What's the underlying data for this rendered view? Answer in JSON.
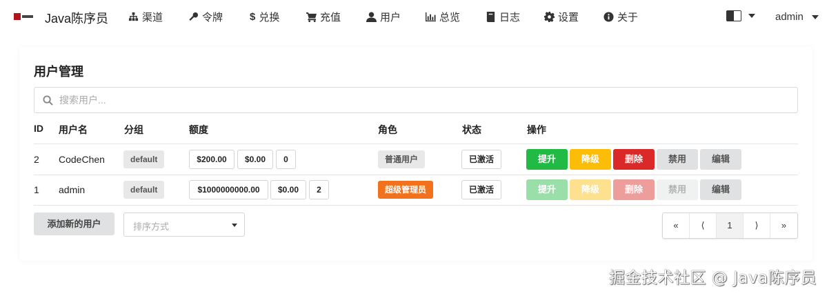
{
  "nav": {
    "brand": "Java陈序员",
    "items": [
      {
        "label": "渠道",
        "icon": "sitemap-icon"
      },
      {
        "label": "令牌",
        "icon": "key-icon"
      },
      {
        "label": "兑换",
        "icon": "dollar-icon"
      },
      {
        "label": "充值",
        "icon": "cart-icon"
      },
      {
        "label": "用户",
        "icon": "user-icon"
      },
      {
        "label": "总览",
        "icon": "bar-chart-icon"
      },
      {
        "label": "日志",
        "icon": "book-icon"
      },
      {
        "label": "设置",
        "icon": "gear-icon"
      },
      {
        "label": "关于",
        "icon": "info-icon"
      }
    ],
    "language_icon": "translate-icon",
    "user": "admin"
  },
  "page": {
    "title": "用户管理",
    "search_placeholder": "搜索用户..."
  },
  "table": {
    "headers": {
      "id": "ID",
      "username": "用户名",
      "group": "分组",
      "quota": "额度",
      "role": "角色",
      "status": "状态",
      "actions": "操作"
    },
    "rows": [
      {
        "id": "2",
        "username": "CodeChen",
        "group": "default",
        "quota": "$200.00",
        "used": "$0.00",
        "requests": "0",
        "role": "普通用户",
        "status": "已激活",
        "actions": {
          "promote": "提升",
          "demote": "降级",
          "delete": "删除",
          "disable": "禁用",
          "edit": "编辑"
        }
      },
      {
        "id": "1",
        "username": "admin",
        "group": "default",
        "quota": "$1000000000.00",
        "used": "$0.00",
        "requests": "2",
        "role": "超级管理员",
        "status": "已激活",
        "actions": {
          "promote": "提升",
          "demote": "降级",
          "delete": "删除",
          "disable": "禁用",
          "edit": "编辑"
        }
      }
    ]
  },
  "footer": {
    "add_user": "添加新的用户",
    "sort_placeholder": "排序方式",
    "pager": {
      "first": "«",
      "prev": "⟨",
      "current": "1",
      "next": "⟩",
      "last": "»"
    }
  },
  "watermark": "掘金技术社区 @ Java陈序员",
  "colors": {
    "green": "#21ba45",
    "yellow": "#fbbd08",
    "red": "#db2828",
    "orange": "#f2711c"
  }
}
